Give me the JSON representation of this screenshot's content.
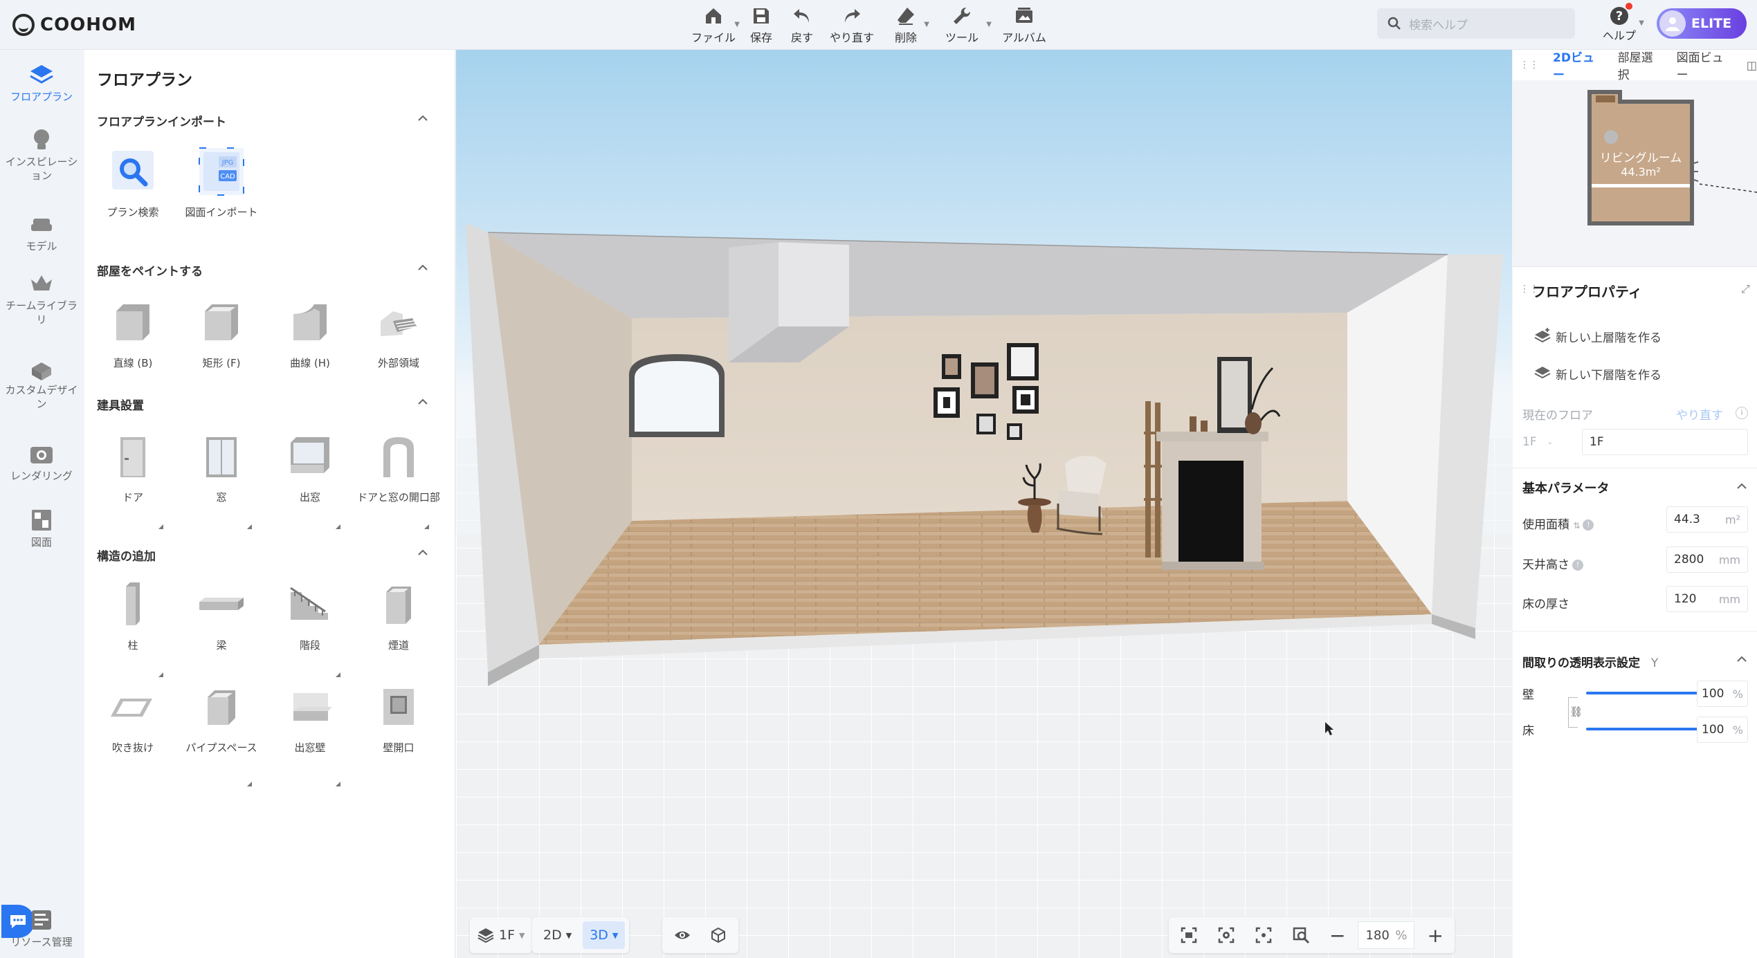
{
  "app": {
    "logo_text": "COOHOM",
    "accent": "#2a76f0"
  },
  "toolbar": {
    "file": "ファイル",
    "save": "保存",
    "undo": "戻す",
    "redo": "やり直す",
    "delete": "削除",
    "tools": "ツール",
    "album": "アルバム"
  },
  "search": {
    "placeholder": "検索ヘルプ"
  },
  "help": {
    "label": "ヘルプ"
  },
  "account": {
    "badge": "ELITE"
  },
  "leftnav": {
    "items": [
      {
        "label": "フロアプラン",
        "icon": "floorplan-icon"
      },
      {
        "label": "インスピレーション",
        "icon": "lightbulb-icon"
      },
      {
        "label": "モデル",
        "icon": "sofa-icon"
      },
      {
        "label": "チームライブラリ",
        "icon": "crown-icon"
      },
      {
        "label": "カスタムデザイン",
        "icon": "custom-design-icon"
      },
      {
        "label": "レンダリング",
        "icon": "camera-icon"
      },
      {
        "label": "図面",
        "icon": "drawing-icon"
      }
    ],
    "resource": "リソース管理"
  },
  "panel": {
    "title": "フロアプラン",
    "sections": {
      "import": {
        "title": "フロアプランインポート",
        "items": [
          "プラン検索",
          "図面インポート"
        ]
      },
      "paint": {
        "title": "部屋をペイントする",
        "items": [
          "直線 (B)",
          "矩形 (F)",
          "曲線 (H)",
          "外部領域"
        ]
      },
      "fixtures": {
        "title": "建具設置",
        "items": [
          "ドア",
          "窓",
          "出窓",
          "ドアと窓の開口部"
        ]
      },
      "structure": {
        "title": "構造の追加",
        "items": [
          "柱",
          "梁",
          "階段",
          "煙道",
          "吹き抜け",
          "パイプスペース",
          "出窓壁",
          "壁開口"
        ]
      }
    },
    "cad_badge_top": "JPG",
    "cad_badge_bottom": "CAD"
  },
  "viewport": {
    "floor": "1F",
    "view_2d": "2D",
    "view_3d": "3D",
    "zoom": "180",
    "zoom_unit": "%"
  },
  "rightpanel": {
    "tabs": [
      "2Dビュー",
      "部屋選択",
      "図面ビュー"
    ],
    "minimap": {
      "room_name": "リビングルーム",
      "room_area": "44.3m²"
    },
    "title": "フロアプロパティ",
    "new_upper": "新しい上層階を作る",
    "new_lower": "新しい下層階を作る",
    "current_floor_label": "現在のフロア",
    "redo_link": "やり直す",
    "floor_select": "1F",
    "floor_name": "1F",
    "basic_params": "基本パラメータ",
    "usable_area_label": "使用面積",
    "usable_area": "44.3",
    "usable_area_unit": "m²",
    "ceiling_label": "天井高さ",
    "ceiling": "2800",
    "ceiling_unit": "mm",
    "floor_thickness_label": "床の厚さ",
    "floor_thickness": "120",
    "floor_thickness_unit": "mm",
    "transparency_title": "間取りの透明表示設定",
    "transparency_key": "Y",
    "wall_label": "壁",
    "wall_value": "100",
    "floor_label": "床",
    "floor_value": "100",
    "percent": "%",
    "wall_opacity": 1.0,
    "floor_opacity": 1.0
  }
}
